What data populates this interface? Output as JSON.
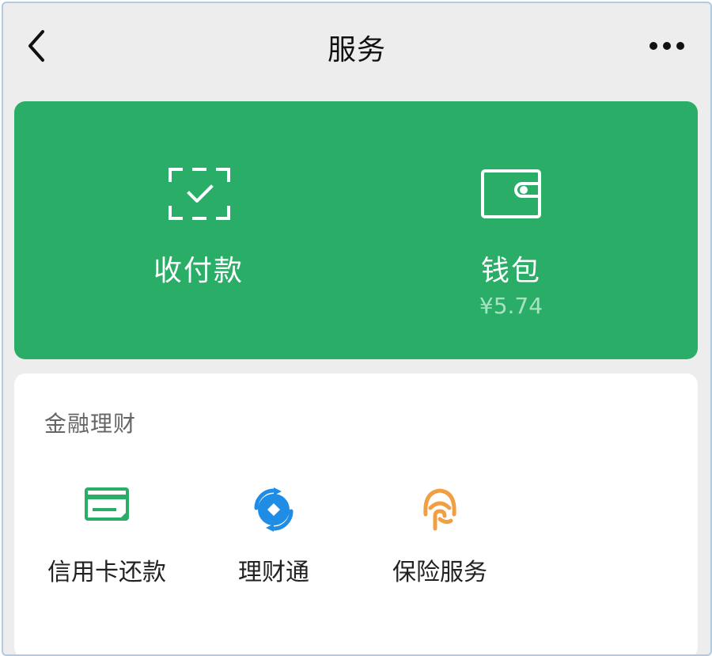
{
  "header": {
    "title": "服务",
    "back_icon": "chevron-left-icon",
    "more_icon": "more-dots-icon"
  },
  "hero": {
    "background_color": "#2aae67",
    "pay": {
      "label": "收付款",
      "icon": "scan-check-icon"
    },
    "wallet": {
      "label": "钱包",
      "balance": "¥5.74",
      "icon": "wallet-icon"
    },
    "annotation_color": "#e53935"
  },
  "finance": {
    "title": "金融理财",
    "items": [
      {
        "label": "信用卡还款",
        "icon": "credit-card-icon",
        "color": "#2aae67"
      },
      {
        "label": "理财通",
        "icon": "licaitong-icon",
        "color": "#1f8ce6"
      },
      {
        "label": "保险服务",
        "icon": "insurance-icon",
        "color": "#f0a042"
      }
    ]
  }
}
